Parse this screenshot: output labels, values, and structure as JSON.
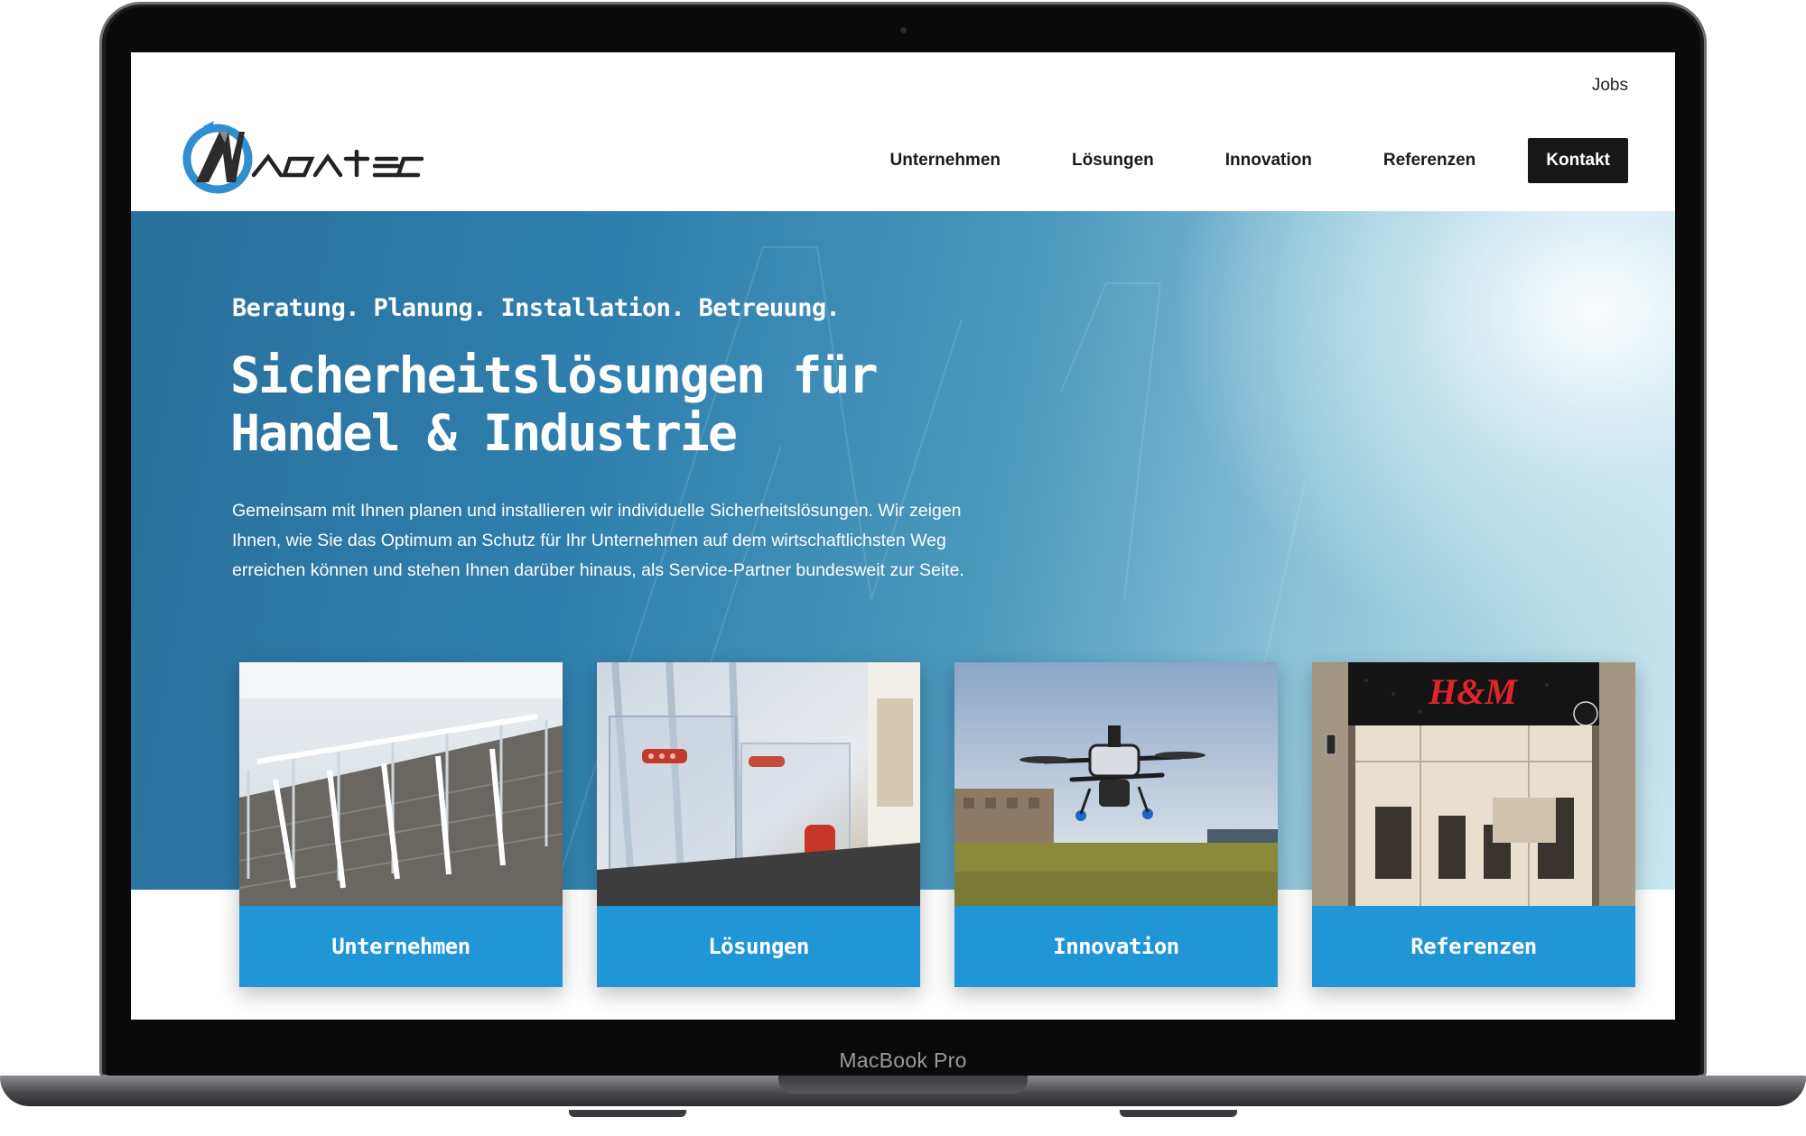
{
  "device": {
    "model_label": "MacBook Pro"
  },
  "header": {
    "jobs_label": "Jobs",
    "logo_text": "ovatec",
    "nav": [
      {
        "label": "Unternehmen"
      },
      {
        "label": "Lösungen"
      },
      {
        "label": "Innovation"
      },
      {
        "label": "Referenzen"
      }
    ],
    "contact_label": "Kontakt"
  },
  "hero": {
    "tagline": "Beratung. Planung. Installation. Betreuung.",
    "title_line1": "Sicherheitslösungen für",
    "title_line2": "Handel & Industrie",
    "text": "Gemeinsam mit Ihnen planen und installieren wir individuelle Sicherheitslösungen. Wir zeigen Ihnen, wie Sie das Optimum an Schutz für Ihr Unternehmen auf dem wirtschaftlichsten Weg erreichen können und stehen Ihnen darüber hinaus, als Service-Partner bundesweit zur Seite."
  },
  "cards": [
    {
      "label": "Unternehmen",
      "image": "security-gates-photo"
    },
    {
      "label": "Lösungen",
      "image": "antenna-sensor-photo"
    },
    {
      "label": "Innovation",
      "image": "drone-photo"
    },
    {
      "label": "Referenzen",
      "image": "store-entrance-photo",
      "store_sign": "H&M"
    }
  ],
  "colors": {
    "accent": "#2196d6",
    "dark": "#171717",
    "logo_blue": "#2f8fd0"
  }
}
